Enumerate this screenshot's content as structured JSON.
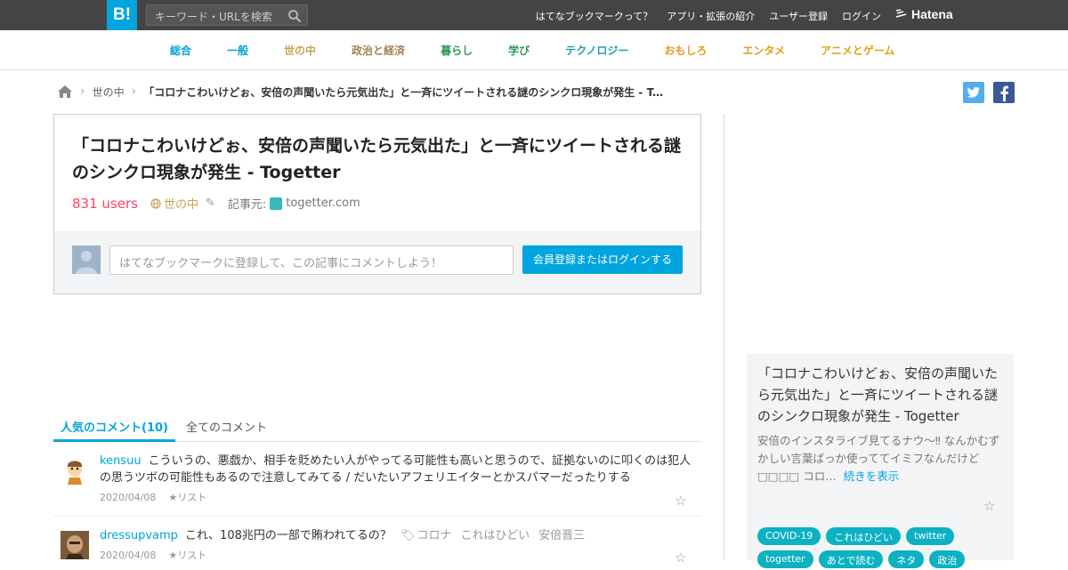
{
  "header": {
    "logo": "B!",
    "search_placeholder": "キーワード・URLを検索",
    "nav": [
      "はてなブックマークって？",
      "アプリ・拡張の紹介",
      "ユーザー登録",
      "ログイン"
    ],
    "brand": "Hatena"
  },
  "categories": [
    {
      "label": "総合",
      "color": "#00a4de"
    },
    {
      "label": "一般",
      "color": "#00a4de"
    },
    {
      "label": "世の中",
      "color": "#c9a356"
    },
    {
      "label": "政治と経済",
      "color": "#a08455"
    },
    {
      "label": "暮らし",
      "color": "#2e9a5a"
    },
    {
      "label": "学び",
      "color": "#2e9a5a"
    },
    {
      "label": "テクノロジー",
      "color": "#1d9bb6"
    },
    {
      "label": "おもしろ",
      "color": "#e59c1b"
    },
    {
      "label": "エンタメ",
      "color": "#e59c1b"
    },
    {
      "label": "アニメとゲーム",
      "color": "#e0a20f"
    }
  ],
  "breadcrumb": {
    "category": "世の中",
    "title": "「コロナこわいけどぉ、安倍の声聞いたら元気出た」と一斉にツイートされる謎のシンクロ現象が発生 - Togetter"
  },
  "entry": {
    "title": "「コロナこわいけどぉ、安倍の声聞いたら元気出た」と一斉にツイートされる謎のシンクロ現象が発生 - Togetter",
    "users": "831 users",
    "category": "世の中",
    "source_label": "記事元:",
    "source": "togetter.com",
    "comment_placeholder": "はてなブックマークに登録して、この記事にコメントしよう！",
    "login_button": "会員登録またはログインする"
  },
  "tabs": {
    "popular": "人気のコメント(10)",
    "all": "全てのコメント"
  },
  "bookmarks": [
    {
      "user": "kensuu",
      "comment": "こういうの、悪戯か、相手を貶めたい人がやってる可能性も高いと思うので、証拠ないのに叩くのは犯人の思うツボの可能性もあるので注意してみてる / だいたいアフェリエイターとかスパマーだったりする",
      "tags": [],
      "date": "2020/04/08",
      "list": "★リスト"
    },
    {
      "user": "dressupvamp",
      "comment": "これ、108兆円の一部で賄われてるの？",
      "tags": [
        "コロナ",
        "これはひどい",
        "安倍晋三"
      ],
      "date": "2020/04/08",
      "list": "★リスト"
    }
  ],
  "sidebar": {
    "title": "「コロナこわいけどぉ、安倍の声聞いたら元気出た」と一斉にツイートされる謎のシンクロ現象が発生 - Togetter",
    "excerpt": "安倍のインスタライブ見てるナウ〜‼ なんかむずかしい言葉ばっか使っててイミフなんだけど□□□□ コロ…",
    "more": "続きを表示",
    "tags": [
      "COVID-19",
      "これはひどい",
      "twitter",
      "togetter",
      "あとで読む",
      "ネタ",
      "政治"
    ]
  }
}
